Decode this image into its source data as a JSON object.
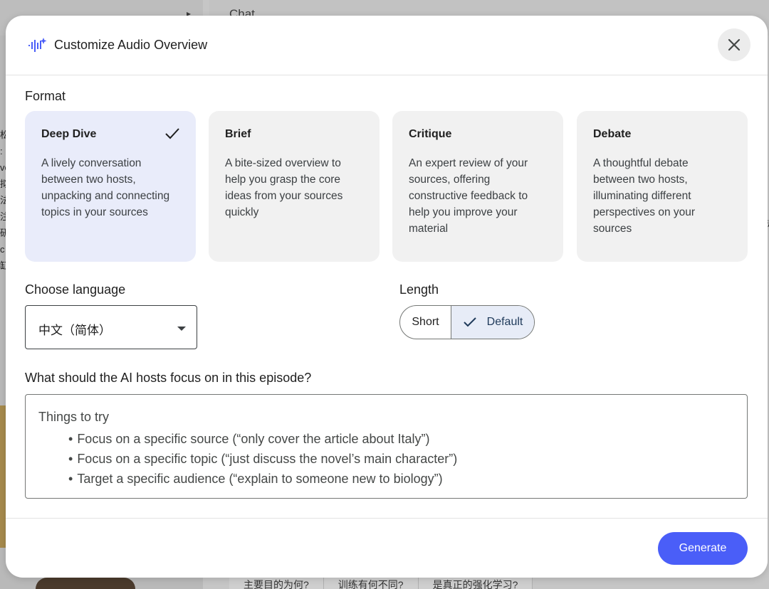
{
  "background": {
    "chat_title": "Chat",
    "chips": [
      "主要目的为何?",
      "训练有何不同?",
      "是真正的强化学习?"
    ],
    "left_strip_text": "松\n:\nve\n拟\n法\n注\n研\nc\n缸",
    "right_strip_text": "护\n\n\n\n\n"
  },
  "dialog": {
    "title": "Customize Audio Overview",
    "icon": "audio-sparkle-icon",
    "close_icon": "close-icon"
  },
  "format": {
    "label": "Format",
    "selected_index": 0,
    "cards": [
      {
        "title": "Deep Dive",
        "description": "A lively conversation between two hosts, unpacking and connecting topics in your sources"
      },
      {
        "title": "Brief",
        "description": "A bite-sized overview to help you grasp the core ideas from your sources quickly"
      },
      {
        "title": "Critique",
        "description": "An expert review of your sources, offering constructive feedback to help you improve your material"
      },
      {
        "title": "Debate",
        "description": "A thoughtful debate between two hosts, illuminating different perspectives on your sources"
      }
    ]
  },
  "language": {
    "label": "Choose language",
    "value": "中文（简体）"
  },
  "length": {
    "label": "Length",
    "options": [
      "Short",
      "Default"
    ],
    "selected": "Default"
  },
  "focus": {
    "label": "What should the AI hosts focus on in this episode?",
    "hint_title": "Things to try",
    "hints": [
      "Focus on a specific source (“only cover the article about Italy”)",
      "Focus on a specific topic (“just discuss the novel’s main character”)",
      "Target a specific audience (“explain to someone new to biology”)"
    ]
  },
  "actions": {
    "generate_label": "Generate"
  },
  "colors": {
    "accent": "#4a5ef8",
    "selected_card": "#e9ecfa",
    "card": "#f1f1f1",
    "scrim": "#9a9a9a"
  }
}
